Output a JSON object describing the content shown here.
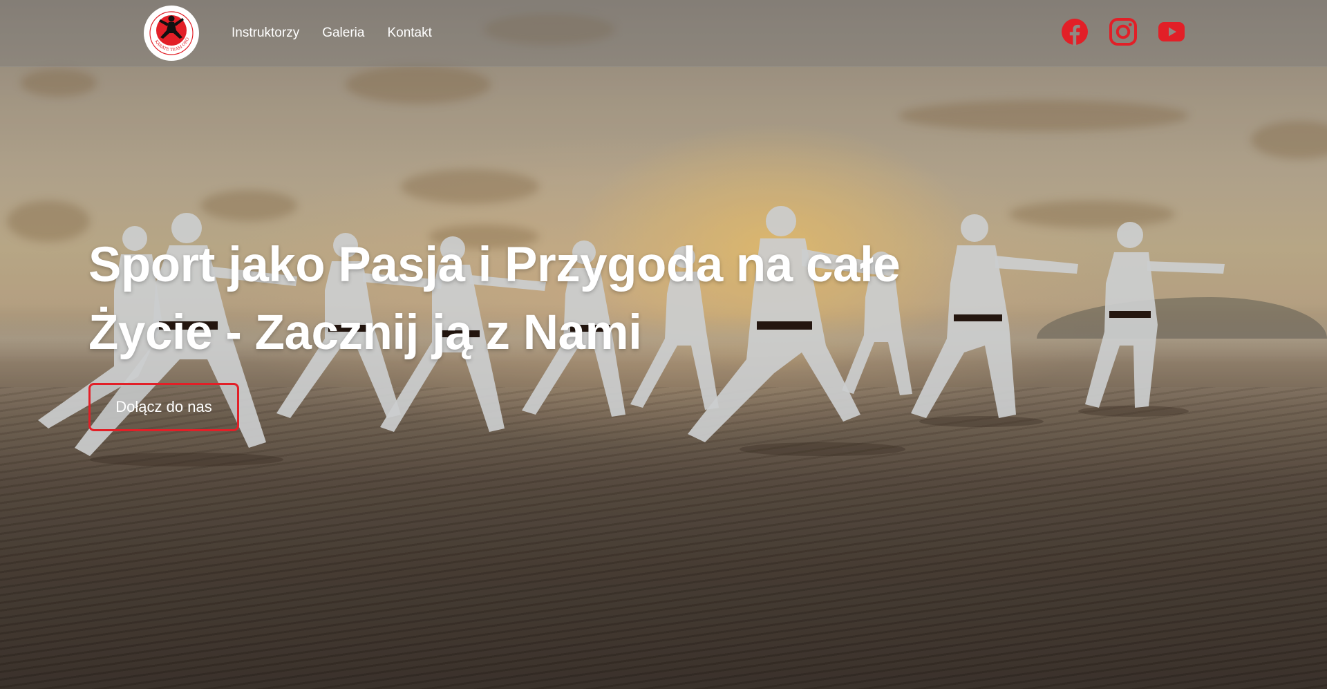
{
  "brand": {
    "logo_text": "KARATE TEAM OBORNIKI",
    "logo_colors": {
      "circle": "#e21f27",
      "ring": "#ffffff",
      "figure": "#111111"
    }
  },
  "nav": {
    "links": [
      {
        "label": "Instruktorzy"
      },
      {
        "label": "Galeria"
      },
      {
        "label": "Kontakt"
      }
    ]
  },
  "social": {
    "icons": [
      "facebook-icon",
      "instagram-icon",
      "youtube-icon"
    ],
    "color": "#e21f27"
  },
  "hero": {
    "headline_line1": "Sport jako Pasja i Przygoda na całe",
    "headline_line2": "Życie - Zacznij ją z Nami",
    "cta_label": "Dołącz do nas",
    "cta_border_color": "#e21f27"
  },
  "background": {
    "description_colors": {
      "sky": "#c8b89d",
      "sun": "#ffd278",
      "sand": "#4b3f35"
    }
  }
}
